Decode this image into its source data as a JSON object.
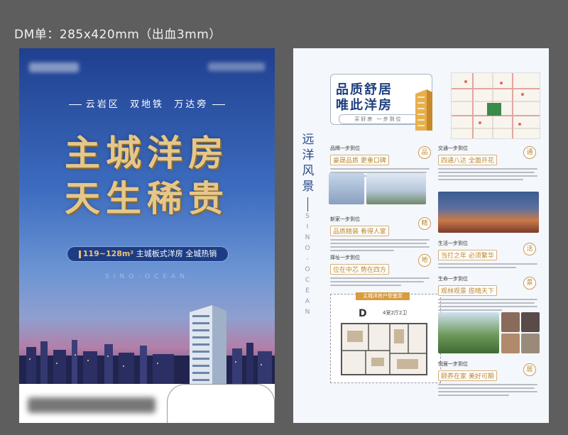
{
  "page_title": "DM单：285x420mm（出血3mm）",
  "front": {
    "tagline": [
      "云岩区",
      "双地铁",
      "万达旁"
    ],
    "headline_line1": "主城洋房",
    "headline_line2": "天生稀贵",
    "pill_area": "119~128m²",
    "pill_text": "主城板式洋房 全城热销",
    "watermark": "SINO-OCEAN"
  },
  "back": {
    "vertical_cn": [
      "远",
      "洋",
      "风",
      "景"
    ],
    "vertical_en": [
      "S",
      "I",
      "N",
      "O",
      "-",
      "O",
      "C",
      "E",
      "A",
      "N"
    ],
    "quote_line1": "品质舒居",
    "quote_line2": "唯此洋房",
    "quote_sub": "买好房 一步到位",
    "sections": [
      {
        "title": "品牌一步到位",
        "tag": "豪晟品质 更重口碑",
        "badge": "品"
      },
      {
        "title": "交通一步到位",
        "tag": "四通八达 全面开花",
        "badge": "通"
      },
      {
        "title": "新家一步到位",
        "tag": "品质精装 看得人家",
        "badge": "精"
      },
      {
        "title": "择址一步到位",
        "tag": "位在中芯 势在四方",
        "badge": "地"
      },
      {
        "title": "生活一步到位",
        "tag": "当打之年 必须繁华",
        "badge": "活"
      },
      {
        "title": "生命一步到位",
        "tag": "观林观景 揽晴天下",
        "badge": "景"
      },
      {
        "title": "悦居一步到位",
        "tag": "颐养在家 美好可期",
        "badge": "居"
      }
    ],
    "plan_header": "主城洋房户型鉴赏",
    "plan_letter": "D",
    "plan_spec": "4室2厅2卫"
  },
  "colors": {
    "front_top": "#1f3f8f",
    "headline_gold": "#e6c78a",
    "accent_gold": "#b8862f",
    "navy": "#1f3f7f"
  }
}
